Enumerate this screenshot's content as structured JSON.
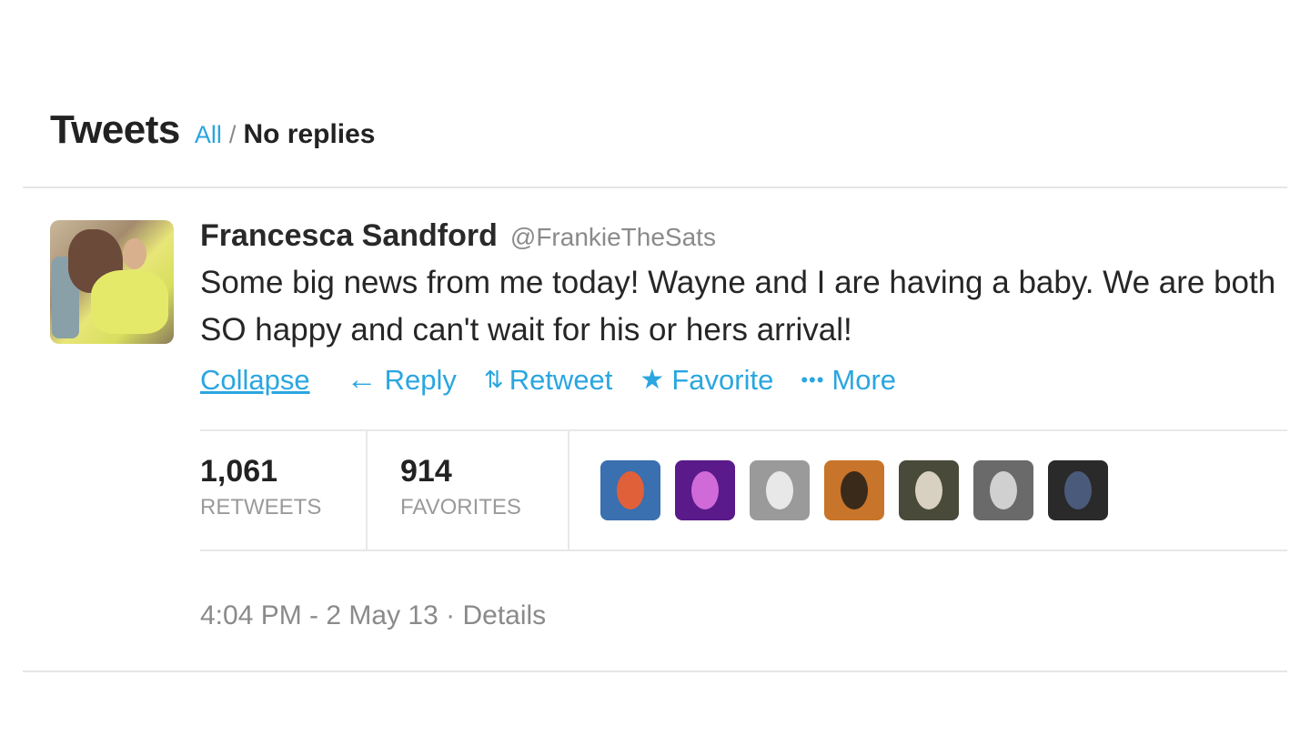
{
  "header": {
    "title": "Tweets",
    "filter_all": "All",
    "filter_separator": "/",
    "filter_no_replies": "No replies"
  },
  "tweet": {
    "author_name": "Francesca Sandford",
    "author_handle": "@FrankieTheSats",
    "text": "Some big news from me today! Wayne and I are having a baby. We are both SO happy and can't wait for his or hers arrival!",
    "actions": {
      "collapse": "Collapse",
      "reply": "Reply",
      "retweet": "Retweet",
      "favorite": "Favorite",
      "more": "More"
    },
    "icons": {
      "reply": "reply-arrow-icon",
      "retweet": "retweet-icon",
      "favorite": "star-icon",
      "more": "ellipsis-icon"
    },
    "stats": {
      "retweets_count": "1,061",
      "retweets_label": "RETWEETS",
      "favorites_count": "914",
      "favorites_label": "FAVORITES"
    },
    "favoriter_avatars": [
      {
        "bg": "#3a6fb0",
        "accent": "#e0603a"
      },
      {
        "bg": "#5a1a8a",
        "accent": "#d06ad8"
      },
      {
        "bg": "#9a9a9a",
        "accent": "#e8e8e8"
      },
      {
        "bg": "#c8742a",
        "accent": "#3a2a1a"
      },
      {
        "bg": "#4a4a3a",
        "accent": "#d8d0c0"
      },
      {
        "bg": "#6a6a6a",
        "accent": "#d0d0d0"
      },
      {
        "bg": "#2a2a2a",
        "accent": "#4a5a7a"
      }
    ],
    "timestamp": "4:04 PM - 2 May 13",
    "timestamp_separator": "·",
    "details": "Details"
  },
  "colors": {
    "link": "#2aa6e0",
    "muted": "#8a8a8a",
    "divider": "#e6e6e6"
  }
}
